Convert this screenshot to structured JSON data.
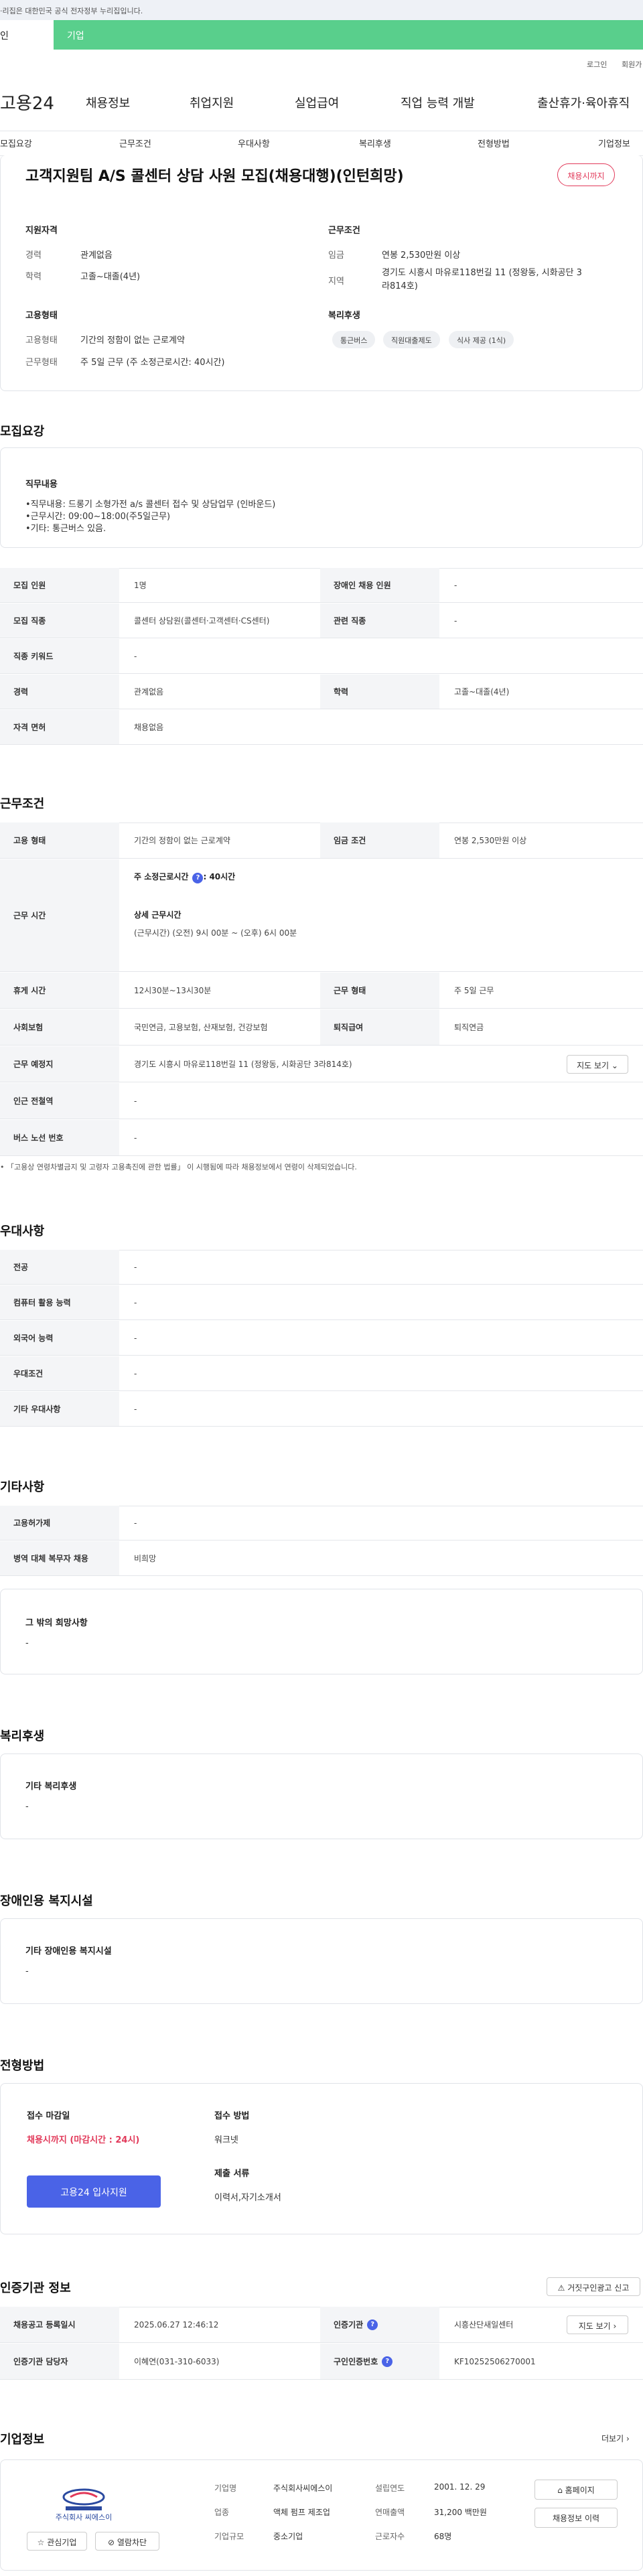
{
  "topbar": {
    "notice": "·리집은 대한민국 공식 전자정부 누리집입니다."
  },
  "tabs": {
    "person": "인",
    "company": "기업"
  },
  "util": {
    "login": "로그인",
    "join": "회원가"
  },
  "logo": {
    "text": "고용24"
  },
  "gnb": [
    "채용정보",
    "취업지원",
    "실업급여",
    "직업 능력 개발",
    "출산휴가·육아휴직"
  ],
  "lnb": [
    "모집요강",
    "근무조건",
    "우대사항",
    "복리후생",
    "전형방법",
    "기업정보"
  ],
  "job": {
    "title": "고객지원팀 A/S 콜센터 상담 사원 모집(채용대행)(인턴희망)",
    "status_pill": "채용시까지"
  },
  "summary": {
    "qual_h": "지원자격",
    "career_l": "경력",
    "career_v": "관계없음",
    "edu_l": "학력",
    "edu_v": "고졸~대졸(4년)",
    "emp_h": "고용형태",
    "emptype_l": "고용형태",
    "emptype_v": "기간의 정함이 없는 근로계약",
    "worktype_l": "근무형태",
    "worktype_v": "주 5일 근무 (주 소정근로시간: 40시간)",
    "cond_h": "근무조건",
    "wage_l": "임금",
    "wage_v": "연봉 2,530만원 이상",
    "region_l": "지역",
    "region_v1": "경기도 시흥시 마유로118번길 11 (정왕동, 시화공단 3",
    "region_v2": "라814호)",
    "welfare_h": "복리후생",
    "chips": [
      "통근버스",
      "직원대출제도",
      "식사 제공 (1식)"
    ]
  },
  "recruit": {
    "h": "모집요강",
    "duty_h": "직무내용",
    "duty_lines": [
      "•직무내용: 드롱기 소형가전 a/s 콜센터 접수 및 상담업무 (인바운드)",
      "•근무시간: 09:00~18:00(주5일근무)",
      "•기타: 통근버스 있음."
    ],
    "rows": [
      {
        "l1": "모집 인원",
        "v1": "1명",
        "l2": "장애인 채용 인원",
        "v2": "-"
      },
      {
        "l1": "모집 직종",
        "v1": "콜센터 상담원(콜센터·고객센터·CS센터)",
        "l2": "관련 직종",
        "v2": "-"
      },
      {
        "l1": "직종 키워드",
        "v1": "-",
        "l2": "",
        "v2": ""
      },
      {
        "l1": "경력",
        "v1": "관계없음",
        "l2": "학력",
        "v2": "고졸~대졸(4년)"
      },
      {
        "l1": "자격 면허",
        "v1": "채용없음",
        "l2": "",
        "v2": ""
      }
    ]
  },
  "work": {
    "h": "근무조건",
    "emp_l": "고용 형태",
    "emp_v": "기간의 정함이 없는 근로계약",
    "wage_l": "임금 조건",
    "wage_v": "연봉 2,530만원 이상",
    "time_l": "근무 시간",
    "time_week": "주 소정근로시간",
    "time_week_v": ": 40시간",
    "time_detail_h": "상세 근무시간",
    "time_detail_v": "(근무시간) (오전) 9시 00분 ~ (오후) 6시 00분",
    "rest_l": "휴게 시간",
    "rest_v": "12시30분~13시30분",
    "form_l": "근무 형태",
    "form_v": "주 5일 근무",
    "ins_l": "사회보험",
    "ins_v": "국민연금, 고용보험, 산재보험, 건강보험",
    "retire_l": "퇴직급여",
    "retire_v": "퇴직연금",
    "place_l": "근무 예정지",
    "place_v": "경기도 시흥시 마유로118번길 11 (정왕동, 시화공단 3라814호)",
    "map_btn": "지도 보기",
    "subway_l": "인근 전철역",
    "subway_v": "-",
    "bus_l": "버스 노선 번호",
    "bus_v": "-",
    "footnote": "「고용상 연령차별금지 및 고령자 고용촉진에 관한 법률」 이 시행됨에 따라 채용정보에서 연령이 삭제되었습니다."
  },
  "pref": {
    "h": "우대사항",
    "rows": [
      {
        "l": "전공",
        "v": "-"
      },
      {
        "l": "컴퓨터 활용 능력",
        "v": "-"
      },
      {
        "l": "외국어 능력",
        "v": "-"
      },
      {
        "l": "우대조건",
        "v": "-"
      },
      {
        "l": "기타 우대사항",
        "v": "-"
      }
    ]
  },
  "etc": {
    "h": "기타사항",
    "rows": [
      {
        "l": "고용허가제",
        "v": "-"
      },
      {
        "l": "병역 대체 복무자 채용",
        "v": "비희망"
      }
    ],
    "other_h": "그 밖의 희망사항",
    "other_v": "-"
  },
  "welfare": {
    "h": "복리후생",
    "box_h": "기타 복리후생",
    "box_v": "-"
  },
  "disab": {
    "h": "장애인용 복지시설",
    "box_h": "기타 장애인용 복지시설",
    "box_v": "-"
  },
  "process": {
    "h": "전형방법",
    "deadline_h": "접수 마감일",
    "deadline_v": "채용시까지 (마감시간 : 24시)",
    "apply_btn": "고용24 입사지원",
    "method_h": "접수 방법",
    "method_v": "워크넷",
    "docs_h": "제출 서류",
    "docs_v": "이력서,자기소개서"
  },
  "agency": {
    "h": "인증기관 정보",
    "report_btn": "거짓구인광고 신고",
    "reg_l": "채용공고 등록일시",
    "reg_v": "2025.06.27 12:46:12",
    "org_l": "인증기관",
    "org_v": "시흥산단새일센터",
    "map_btn": "지도 보기",
    "mgr_l": "인증기관 담당자",
    "mgr_v": "이혜연(031-310-6033)",
    "num_l": "구인인증번호",
    "num_v": "KF10252506270001"
  },
  "company": {
    "h": "기업정보",
    "more": "더보기",
    "logo_text": "주식회사 씨에스이",
    "name_l": "기업명",
    "name_v": "주식회사씨에스이",
    "est_l": "설립연도",
    "est_v": "2001. 12. 29",
    "ind_l": "업종",
    "ind_v": "액체 펌프 제조업",
    "sales_l": "연매출액",
    "sales_v": "31,200 백만원",
    "size_l": "기업규모",
    "size_v": "중소기업",
    "emp_l": "근로자수",
    "emp_v": "68명",
    "home_btn": "홈페이지",
    "jobs_btn": "채용정보 이력",
    "fav_btn": "관심기업",
    "block_btn": "열람차단"
  },
  "colors": {
    "green": "#59cf8c",
    "primary": "#4a63e7",
    "red": "#e23a5a"
  }
}
